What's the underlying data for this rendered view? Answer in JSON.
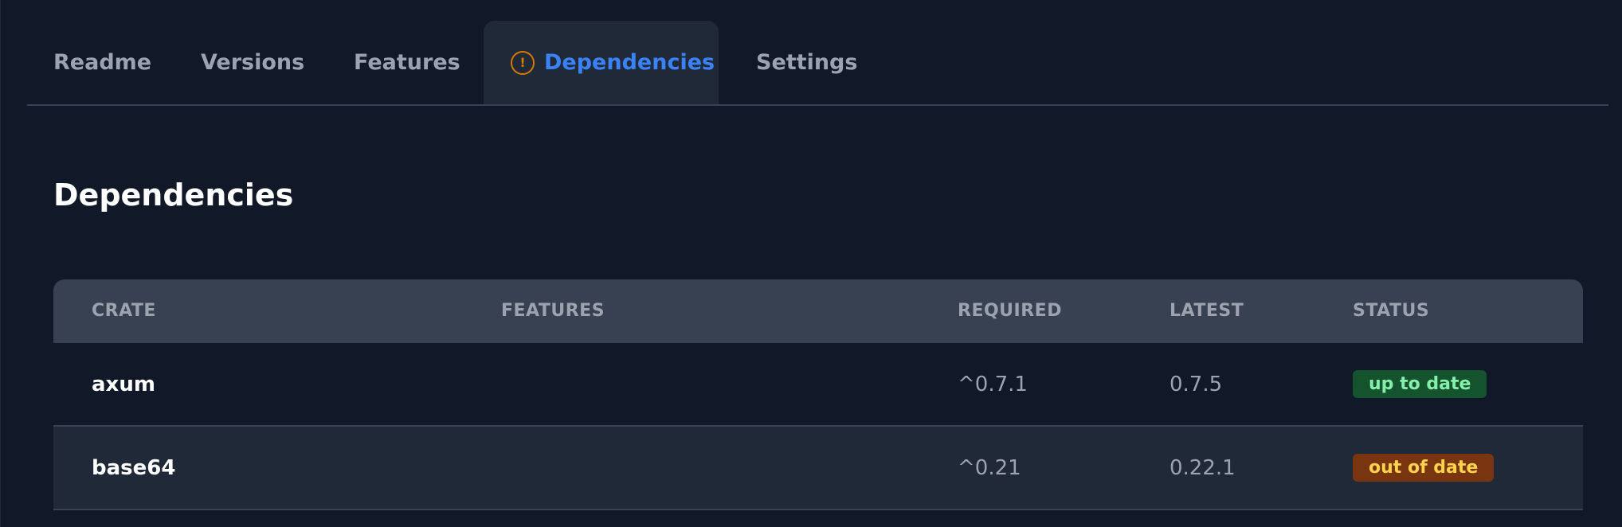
{
  "tabs": [
    {
      "label": "Readme",
      "active": false
    },
    {
      "label": "Versions",
      "active": false
    },
    {
      "label": "Features",
      "active": false
    },
    {
      "label": "Dependencies",
      "active": true,
      "icon": "warning-circle-icon"
    },
    {
      "label": "Settings",
      "active": false
    }
  ],
  "section": {
    "title": "Dependencies"
  },
  "table": {
    "columns": [
      "CRATE",
      "FEATURES",
      "REQUIRED",
      "LATEST",
      "STATUS"
    ],
    "rows": [
      {
        "crate": "axum",
        "features": "",
        "required": "^0.7.1",
        "latest": "0.7.5",
        "status": "up to date"
      },
      {
        "crate": "base64",
        "features": "",
        "required": "^0.21",
        "latest": "0.22.1",
        "status": "out of date"
      }
    ]
  },
  "colors": {
    "background": "#111827",
    "active_tab": "#3b82f6",
    "warning": "#d97706",
    "up_to_date_bg": "#14532d",
    "up_to_date_text": "#86efac",
    "out_of_date_bg": "#78350f",
    "out_of_date_text": "#fcd34d"
  }
}
